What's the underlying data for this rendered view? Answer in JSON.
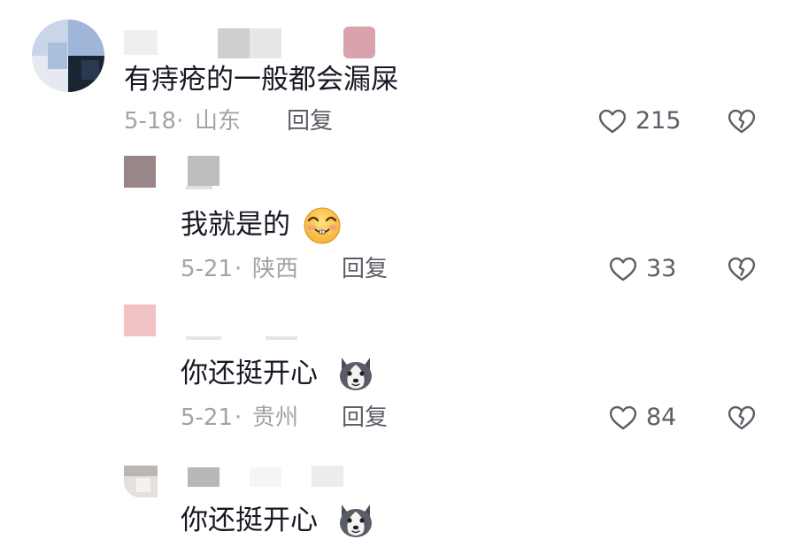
{
  "comments": [
    {
      "text": "有痔疮的一般都会漏屎",
      "date": "5-18",
      "location": "山东",
      "reply_label": "回复",
      "likes": "215"
    },
    {
      "text": "我就是的",
      "emoji": "grinning-emoji",
      "date": "5-21",
      "location": "陕西",
      "reply_label": "回复",
      "likes": "33"
    },
    {
      "text": "你还挺开心",
      "emoji": "husky-dog-emoji",
      "date": "5-21",
      "location": "贵州",
      "reply_label": "回复",
      "likes": "84"
    },
    {
      "text": "你还挺开心",
      "emoji": "husky-dog-emoji"
    }
  ],
  "icons": {
    "like": "heart-outline-icon",
    "dislike": "broken-heart-icon"
  },
  "colors": {
    "text": "#161823",
    "meta": "#a2a3a8",
    "secondary": "#5c5e66"
  }
}
